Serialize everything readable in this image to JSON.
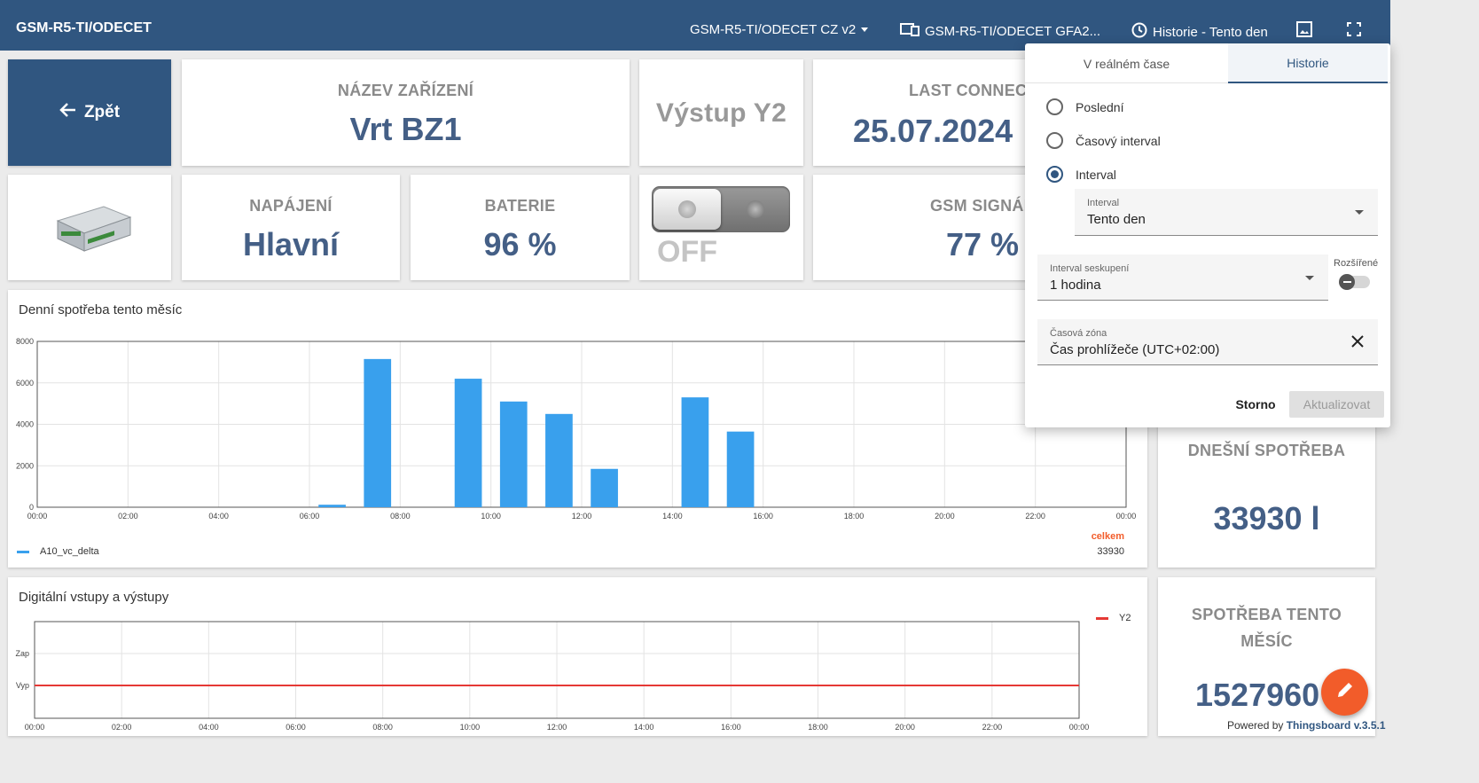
{
  "topbar": {
    "title": "GSM-R5-TI/ODECET",
    "dashboard_select": "GSM-R5-TI/ODECET CZ v2",
    "device_select": "GSM-R5-TI/ODECET GFA2...",
    "history_button": "Historie - Tento den",
    "icons": [
      "devices-icon",
      "clock-icon",
      "image-export-icon",
      "fullscreen-icon"
    ]
  },
  "cards": {
    "back_label": "Zpět",
    "device_name_label": "NÁZEV ZAŘÍZENÍ",
    "device_name_value": "Vrt BZ1",
    "output_label": "Výstup Y2",
    "last_connect_label": "LAST CONNECT",
    "last_connect_value": "25.07.2024",
    "power_label": "NAPÁJENÍ",
    "power_value": "Hlavní",
    "battery_label": "BATERIE",
    "battery_value": "96 %",
    "switch_state": "OFF",
    "gsm_label": "GSM SIGNÁL",
    "gsm_value": "77 %",
    "today_label": "DNEŠNÍ SPOTŘEBA",
    "today_value": "33930 l",
    "month_label_1": "SPOTŘEBA TENTO",
    "month_label_2": "MĚSÍC",
    "month_value": "1527960"
  },
  "chart1_title": "Denní spotřeba tento měsíc",
  "chart2_title": "Digitální vstupy a výstupy",
  "legend1": {
    "series": "A10_vc_delta",
    "total_label": "celkem",
    "total_value": "33930"
  },
  "legend2": {
    "series": "Y2"
  },
  "chart_data": [
    {
      "type": "bar",
      "title": "Denní spotřeba tento měsíc",
      "x_ticks": [
        "00:00",
        "02:00",
        "04:00",
        "06:00",
        "08:00",
        "10:00",
        "12:00",
        "14:00",
        "16:00",
        "18:00",
        "20:00",
        "22:00",
        "00:00"
      ],
      "y_ticks": [
        "0",
        "2000",
        "4000",
        "6000",
        "8000"
      ],
      "ylim": [
        0,
        8000
      ],
      "bar_width_hours": 0.6,
      "series": [
        {
          "name": "A10_vc_delta",
          "color": "#39a0ed",
          "points": [
            [
              6,
              120
            ],
            [
              7,
              7150
            ],
            [
              9,
              6200
            ],
            [
              10,
              5100
            ],
            [
              11,
              4500
            ],
            [
              12,
              1850
            ],
            [
              14,
              5300
            ],
            [
              15,
              3650
            ]
          ]
        }
      ],
      "grid": true,
      "legend": "bottom-left"
    },
    {
      "type": "line",
      "title": "Digitální vstupy a výstupy",
      "x_ticks": [
        "00:00",
        "02:00",
        "04:00",
        "06:00",
        "08:00",
        "10:00",
        "12:00",
        "14:00",
        "16:00",
        "18:00",
        "20:00",
        "22:00",
        "00:00"
      ],
      "y_ticks": [
        "Vyp",
        "Zap"
      ],
      "series": [
        {
          "name": "Y2",
          "color": "#e53935",
          "values": [
            "Vyp"
          ]
        }
      ],
      "grid": true,
      "legend": "top-right"
    }
  ],
  "popup": {
    "tab_realtime": "V reálném čase",
    "tab_history": "Historie",
    "radio_last": "Poslední",
    "radio_range": "Časový interval",
    "radio_interval": "Interval",
    "interval_label": "Interval",
    "interval_value": "Tento den",
    "grouping_label": "Interval seskupení",
    "grouping_value": "1 hodina",
    "advanced_label": "Rozšířené",
    "timezone_label": "Časová zóna",
    "timezone_value": "Čas prohlížeče (UTC+02:00)",
    "cancel": "Storno",
    "update": "Aktualizovat"
  },
  "footer": {
    "powered_by": "Powered by",
    "brand": "Thingsboard v.3.5.1"
  },
  "colors": {
    "primary": "#305680",
    "value": "#445f86",
    "bar": "#39a0ed",
    "line": "#e53935",
    "fab": "#f25c2a"
  }
}
